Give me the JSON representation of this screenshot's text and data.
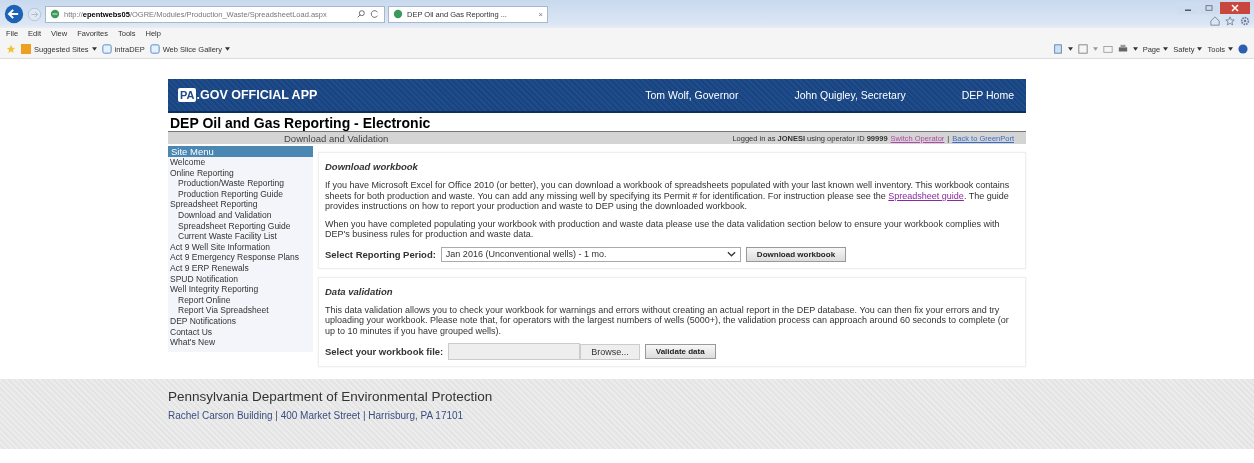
{
  "browser": {
    "address": "http://**epentwebs05**/OGRE/Modules/Production_Waste/SpreadsheetLoad.aspx",
    "tab": {
      "title": "DEP Oil and Gas Reporting ...",
      "close": "×",
      "selected": true
    },
    "menu": [
      "File",
      "Edit",
      "View",
      "Favorites",
      "Tools",
      "Help"
    ],
    "favorites": [
      {
        "label": "Suggested Sites",
        "kind": "dropdown"
      },
      {
        "label": "intraDEP",
        "kind": "page"
      },
      {
        "label": "Web Slice Gallery",
        "kind": "pagedropdown"
      }
    ],
    "commands": [
      "Page",
      "Safety",
      "Tools"
    ]
  },
  "banner": {
    "logo_badge": "PA",
    "logo_text": ".GOV OFFICIAL APP",
    "links": [
      "Tom Wolf, Governor",
      "John Quigley, Secretary",
      "DEP Home"
    ]
  },
  "app_title": "DEP Oil and Gas Reporting - Electronic",
  "subheader": {
    "page": "Download and Validation",
    "login": "Logged in as **JONESI** using operator ID **99999**",
    "links": [
      "Switch Operator",
      "Back to GreenPort"
    ],
    "separator": "|"
  },
  "sidebar": {
    "title": "Site Menu",
    "items": [
      {
        "label": "Welcome"
      },
      {
        "label": "Online Reporting",
        "children": [
          {
            "label": "Production/Waste Reporting"
          },
          {
            "label": "Production Reporting Guide"
          }
        ]
      },
      {
        "label": "Spreadsheet Reporting",
        "children": [
          {
            "label": "Download and Validation"
          },
          {
            "label": "Spreadsheet Reporting Guide"
          },
          {
            "label": "Current Waste Facility List"
          }
        ]
      },
      {
        "label": "Act 9 Well Site Information"
      },
      {
        "label": "Act 9 Emergency Response Plans"
      },
      {
        "label": "Act 9 ERP Renewals"
      },
      {
        "label": "SPUD Notification"
      },
      {
        "label": "Well Integrity Reporting",
        "children": [
          {
            "label": "Report Online"
          },
          {
            "label": "Report Via Spreadsheet"
          }
        ]
      },
      {
        "label": "DEP Notifications"
      },
      {
        "label": "Contact Us"
      },
      {
        "label": "What's New"
      }
    ]
  },
  "download": {
    "title": "Download workbook",
    "paragraph_1": {
      "before": "If you have Microsoft Excel for Office 2010 (or better), you can download a workbook of spreadsheets populated with your last known well inventory. This workbook contains sheets for both production and waste. You can add any missing well by specifying its Permit # for identification. For instruction please see the ",
      "link": "Spreadsheet guide",
      "after": ". The guide provides instructions on how to report your production and waste to DEP using the downloaded workbook."
    },
    "paragraph_2": "When you have completed populating your workbook with production and waste data please use the data validation section below to ensure your workbook complies with DEP's business rules for production and waste data.",
    "period_label": "Select Reporting Period:",
    "period_value": "Jan 2016 (Unconventional wells) - 1 mo.",
    "button": "Download workbook"
  },
  "validation": {
    "title": "Data validation",
    "paragraph": "This data validation allows you to check your workbook for warnings and errors without creating an actual report in the DEP database. You can then fix your errors and try uploading your workbook. Please note that, for operators with the largest numbers of wells (5000+), the validation process can approach around 60 seconds to complete (or up to 10 minutes if you have grouped wells).",
    "file_label": "Select your workbook file:",
    "browse": "Browse...",
    "button": "Validate data"
  },
  "footer": {
    "title": "Pennsylvania Department of Environmental Protection",
    "address": "Rachel Carson Building | 400 Market Street | Harrisburg, PA 17101"
  }
}
